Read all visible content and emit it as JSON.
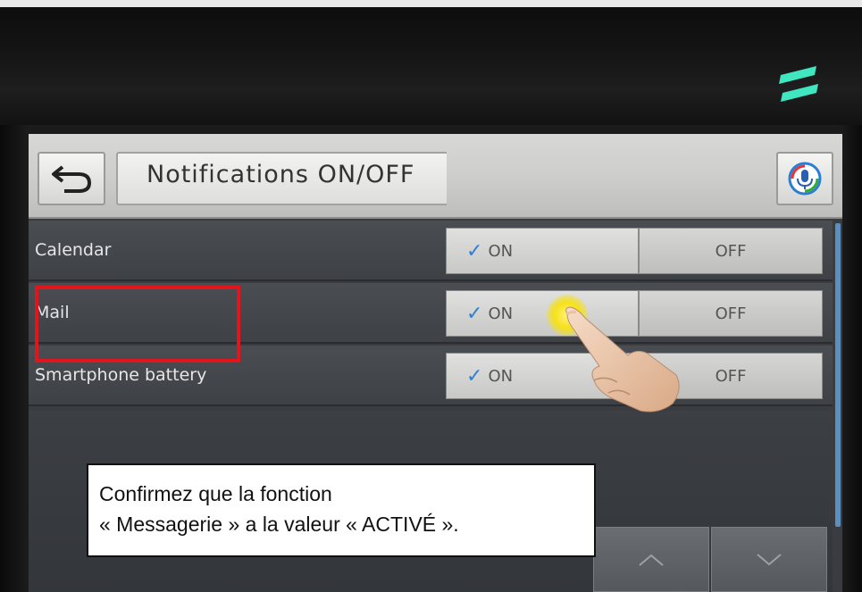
{
  "header": {
    "title": "Notifications ON/OFF",
    "back_icon": "back-arrow-icon",
    "mic_icon": "microphone-icon"
  },
  "settings": [
    {
      "label": "Calendar",
      "on_label": "ON",
      "off_label": "OFF",
      "state": "ON"
    },
    {
      "label": "Mail",
      "on_label": "ON",
      "off_label": "OFF",
      "state": "ON"
    },
    {
      "label": "Smartphone battery",
      "on_label": "ON",
      "off_label": "OFF",
      "state": "ON"
    }
  ],
  "caption": {
    "line1": "Confirmez que la fonction",
    "line2": "« Messagerie » a la valeur « ACTIVÉ »."
  },
  "colors": {
    "highlight": "#e1151b",
    "check": "#2d7fd6",
    "tap": "#f5e11a"
  }
}
